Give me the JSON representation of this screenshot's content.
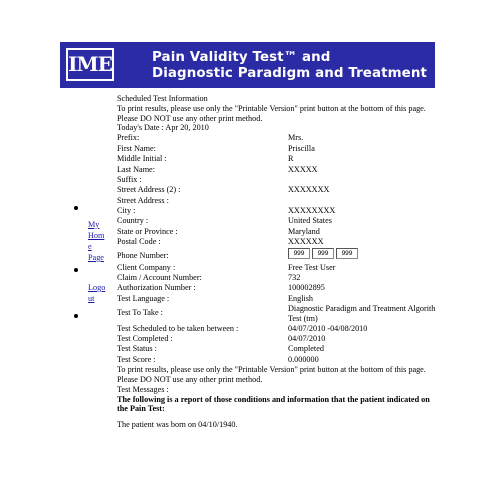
{
  "header": {
    "logo_text": "IME",
    "title_line1": "Pain Validity Test™ and",
    "title_line2": "Diagnostic Paradigm and Treatment"
  },
  "sidebar": {
    "my_home": [
      "My",
      "Hom",
      "e",
      "Page"
    ],
    "logout": [
      "Logo",
      "ut"
    ]
  },
  "content": {
    "heading": "Scheduled Test Information",
    "print_note": "To print results, please use only the \"Printable Version\" print button at the bottom of this page. Please DO NOT use any other print method.",
    "todays_date": "Today's Date : Apr 20, 2010",
    "fields": [
      {
        "label": "Prefix:",
        "value": "Mrs."
      },
      {
        "label": "First Name:",
        "value": "Priscilla"
      },
      {
        "label": "Middle Initial :",
        "value": "R"
      },
      {
        "label": "Last Name:",
        "value": "XXXXX"
      },
      {
        "label": "Suffix :",
        "value": ""
      },
      {
        "label": "Street Address (2) :",
        "value": "XXXXXXX"
      },
      {
        "label": "Street Address :",
        "value": ""
      },
      {
        "label": "City :",
        "value": "XXXXXXXX"
      },
      {
        "label": "Country :",
        "value": "United States"
      },
      {
        "label": "State or Province :",
        "value": "Maryland"
      },
      {
        "label": "Postal Code :",
        "value": "XXXXXX"
      }
    ],
    "phone": {
      "label": "Phone Number:",
      "parts": [
        "999",
        "999",
        "999"
      ]
    },
    "fields2": [
      {
        "label": "Client Company :",
        "value": "Free Test User"
      },
      {
        "label": "Claim / Account Number:",
        "value": "732"
      },
      {
        "label": "Authorization Number :",
        "value": "100002895"
      },
      {
        "label": "Test Language :",
        "value": "English"
      }
    ],
    "test_to_take": {
      "label": "Test To Take :",
      "value": "Diagnostic Paradigm and Treatment Algorith Test (tm)"
    },
    "fields3": [
      {
        "label": "Test Scheduled to be taken between :",
        "value": "04/07/2010 -04/08/2010"
      },
      {
        "label": "Test Completed :",
        "value": "04/07/2010"
      },
      {
        "label": "Test Status :",
        "value": "Completed"
      },
      {
        "label": "Test Score :",
        "value": "0.000000"
      }
    ],
    "print_note2": "To print results, please use only the \"Printable Version\" print button at the bottom of this page. Please DO NOT use any other print method.",
    "test_messages": "Test Messages :",
    "following_note": "The following is a report of those conditions and information that the patient indicated on the Pain Test:",
    "born_note": "The patient was born on 04/10/1940."
  }
}
